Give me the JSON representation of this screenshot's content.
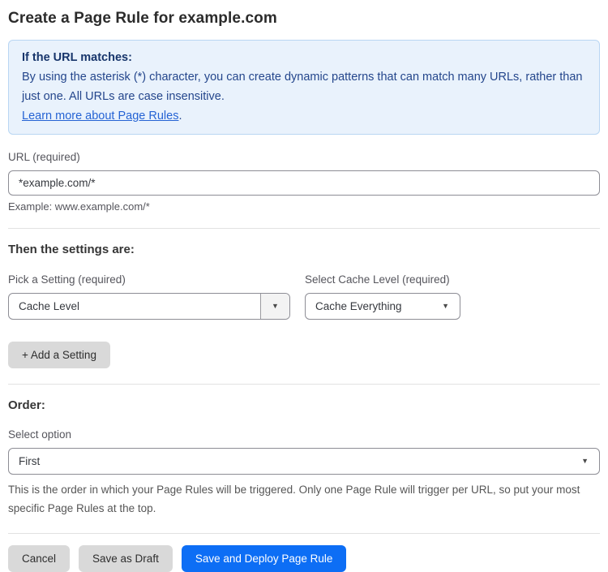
{
  "page": {
    "title": "Create a Page Rule for example.com"
  },
  "info_box": {
    "heading": "If the URL matches:",
    "body": "By using the asterisk (*) character, you can create dynamic patterns that can match many URLs, rather than just one. All URLs are case insensitive.",
    "link_label": "Learn more about Page Rules",
    "link_suffix": "."
  },
  "url_field": {
    "label": "URL (required)",
    "value": "*example.com/*",
    "helper": "Example: www.example.com/*"
  },
  "settings_section": {
    "heading": "Then the settings are:",
    "setting_picker": {
      "label": "Pick a Setting (required)",
      "value": "Cache Level"
    },
    "cache_level_picker": {
      "label": "Select Cache Level (required)",
      "value": "Cache Everything"
    },
    "add_setting_label": "+ Add a Setting",
    "dropdown_arrow": "▼"
  },
  "order_section": {
    "heading": "Order:",
    "select_label": "Select option",
    "value": "First",
    "helper": "This is the order in which your Page Rules will be triggered. Only one Page Rule will trigger per URL, so put your most specific Page Rules at the top.",
    "dropdown_arrow": "▼"
  },
  "footer": {
    "cancel_label": "Cancel",
    "save_draft_label": "Save as Draft",
    "save_deploy_label": "Save and Deploy Page Rule"
  },
  "colors": {
    "info_bg": "#e9f2fc",
    "info_border": "#b9d6f3",
    "info_heading": "#17356b",
    "info_text": "#24468c",
    "link": "#2563d4",
    "primary_button": "#0d6ef5",
    "gray_button": "#d9d9d9"
  }
}
